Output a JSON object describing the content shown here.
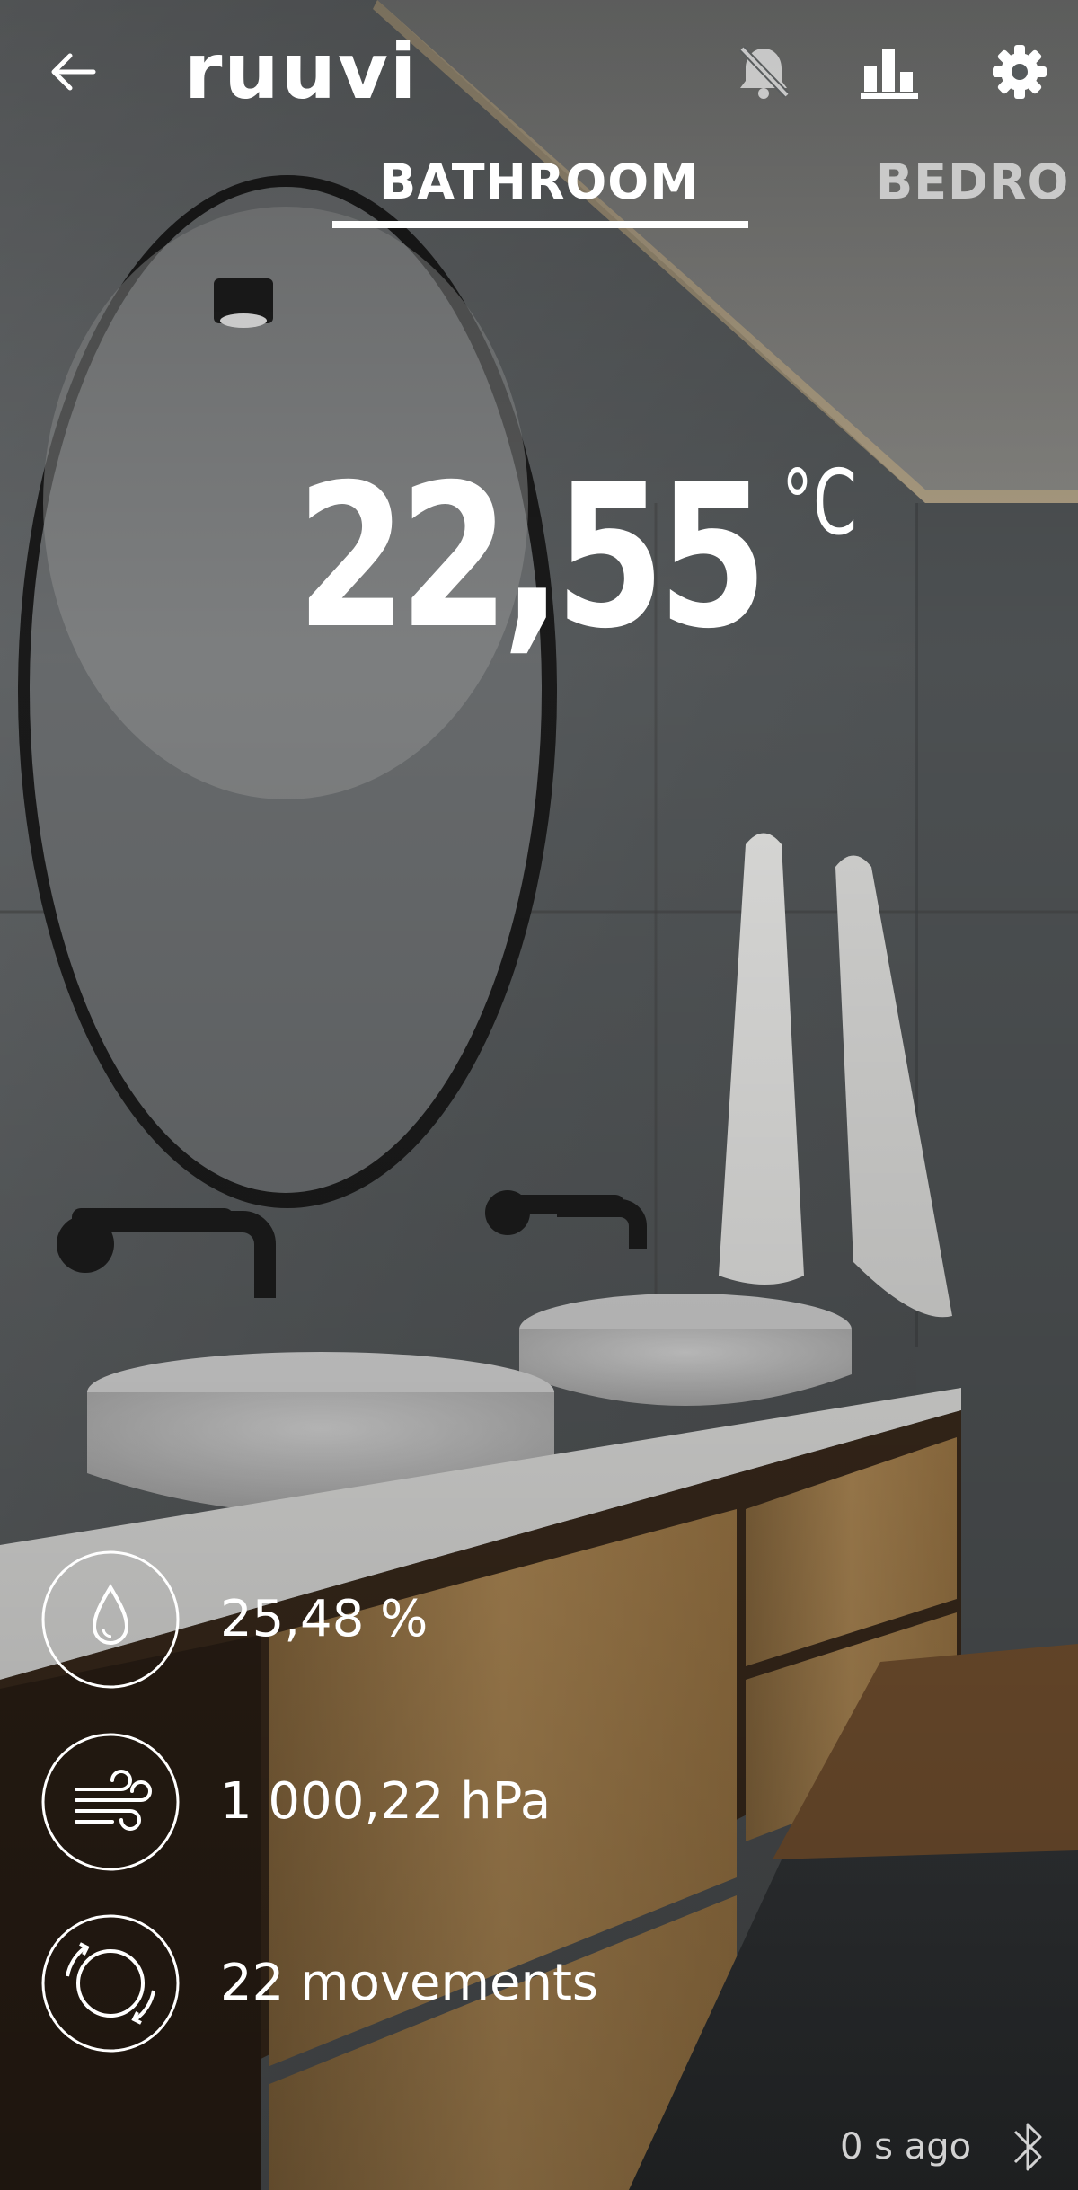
{
  "header": {
    "logo_text": "ruuvi",
    "back_icon": "arrow-left-icon",
    "alerts_icon": "bell-off-icon",
    "history_icon": "bar-chart-icon",
    "settings_icon": "gear-icon"
  },
  "tabs": [
    {
      "label": "BATHROOM",
      "active": true
    },
    {
      "label": "BEDRO",
      "active": false
    }
  ],
  "sensor": {
    "temperature": "22,55",
    "temperature_unit": "°C",
    "humidity": "25,48 %",
    "pressure": "1 000,22 hPa",
    "movements": "22 movements",
    "last_updated": "0 s ago"
  },
  "colors": {
    "text": "#ffffff",
    "wall": "#5f6366",
    "wood": "#b9925b"
  }
}
